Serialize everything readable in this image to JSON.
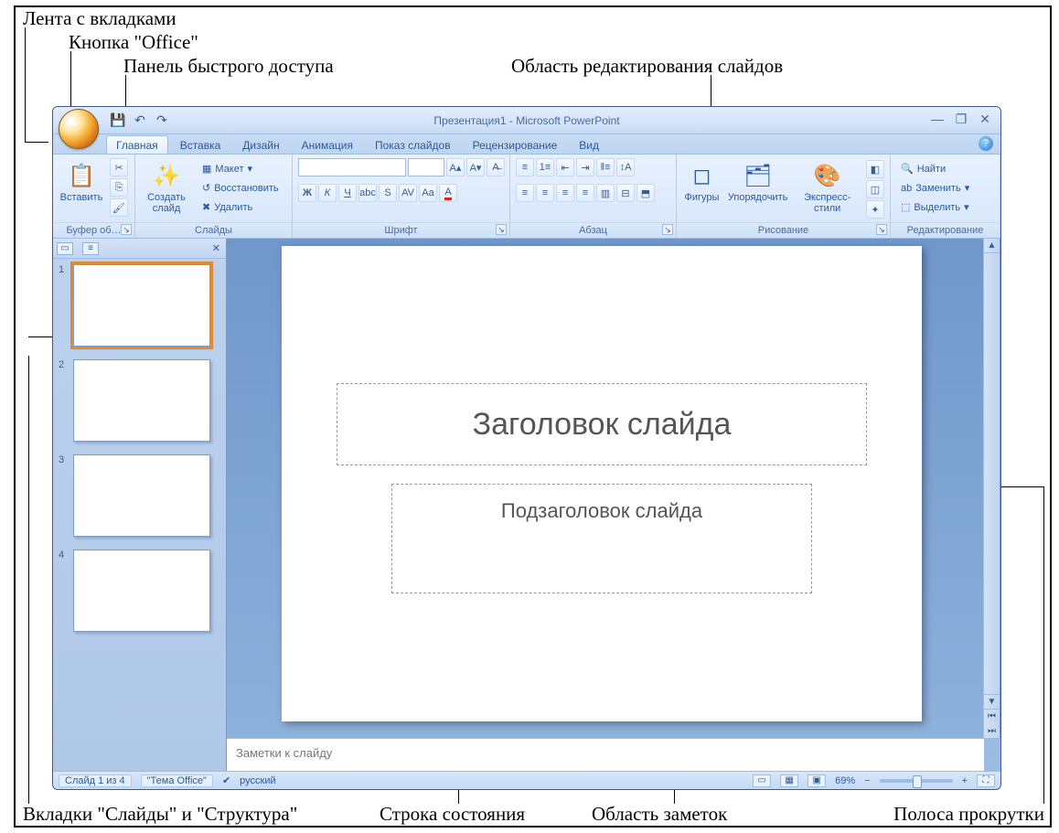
{
  "annotations": {
    "ribbon_tabs": "Лента с вкладками",
    "office_button": "Кнопка \"Office\"",
    "quick_access": "Панель быстрого доступа",
    "edit_area": "Область редактирования слайдов",
    "slides_outline_tabs": "Вкладки \"Слайды\" и \"Структура\"",
    "status_bar": "Строка состояния",
    "notes_area": "Область заметок",
    "scrollbar": "Полоса прокрутки"
  },
  "window": {
    "title": "Презентация1 - Microsoft PowerPoint"
  },
  "tabs": {
    "items": [
      "Главная",
      "Вставка",
      "Дизайн",
      "Анимация",
      "Показ слайдов",
      "Рецензирование",
      "Вид"
    ],
    "active_index": 0
  },
  "ribbon": {
    "clipboard": {
      "title": "Буфер об…",
      "paste": "Вставить"
    },
    "slides_group": {
      "title": "Слайды",
      "new_slide": "Создать\nслайд",
      "layout": "Макет",
      "reset": "Восстановить",
      "delete": "Удалить"
    },
    "font": {
      "title": "Шрифт"
    },
    "paragraph": {
      "title": "Абзац"
    },
    "drawing": {
      "title": "Рисование",
      "shapes": "Фигуры",
      "arrange": "Упорядочить",
      "quick_styles": "Экспресс-стили"
    },
    "editing": {
      "title": "Редактирование",
      "find": "Найти",
      "replace": "Заменить",
      "select": "Выделить"
    }
  },
  "slide": {
    "title_placeholder": "Заголовок слайда",
    "subtitle_placeholder": "Подзаголовок слайда"
  },
  "thumbnails": {
    "count": 4,
    "selected": 1
  },
  "notes": {
    "placeholder": "Заметки к слайду"
  },
  "status": {
    "slide_counter": "Слайд 1 из 4",
    "theme": "\"Тема Office\"",
    "language": "русский",
    "zoom": "69%"
  }
}
